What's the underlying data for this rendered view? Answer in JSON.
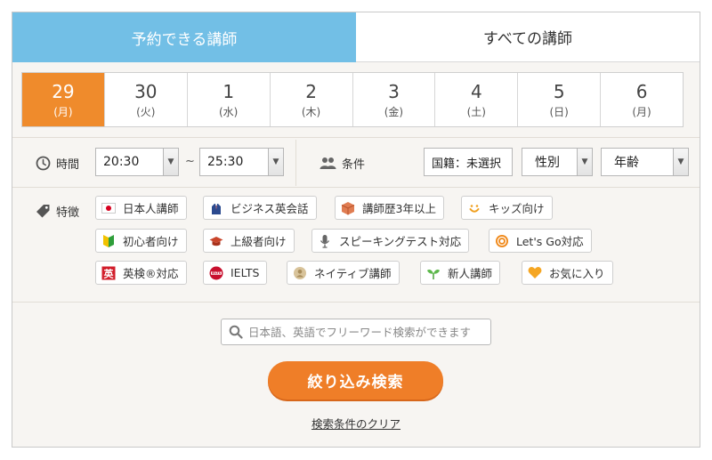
{
  "tabs": [
    {
      "label": "予約できる講師",
      "active": true
    },
    {
      "label": "すべての講師",
      "active": false
    }
  ],
  "dates": [
    {
      "day": "29",
      "weekday": "(月)",
      "selected": true
    },
    {
      "day": "30",
      "weekday": "(火)",
      "selected": false
    },
    {
      "day": "1",
      "weekday": "(水)",
      "selected": false
    },
    {
      "day": "2",
      "weekday": "(木)",
      "selected": false
    },
    {
      "day": "3",
      "weekday": "(金)",
      "selected": false
    },
    {
      "day": "4",
      "weekday": "(土)",
      "selected": false
    },
    {
      "day": "5",
      "weekday": "(日)",
      "selected": false
    },
    {
      "day": "6",
      "weekday": "(月)",
      "selected": false
    }
  ],
  "time": {
    "label": "時間",
    "icon": "clock-icon",
    "from": "20:30",
    "separator": "~",
    "to": "25:30"
  },
  "conditions": {
    "label": "条件",
    "icon": "people-icon",
    "nationality": "国籍：未選択",
    "gender": "性別",
    "age": "年齢"
  },
  "features": {
    "label": "特徴",
    "icon": "tag-icon",
    "chips": [
      {
        "label": "日本人講師",
        "icon": "japan-flag-icon"
      },
      {
        "label": "ビジネス英会話",
        "icon": "business-suit-icon"
      },
      {
        "label": "講師歴3年以上",
        "icon": "cube-icon"
      },
      {
        "label": "キッズ向け",
        "icon": "smile-icon"
      },
      {
        "label": "初心者向け",
        "icon": "beginner-mark-icon"
      },
      {
        "label": "上級者向け",
        "icon": "graduation-cap-icon"
      },
      {
        "label": "スピーキングテスト対応",
        "icon": "microphone-icon"
      },
      {
        "label": "Let's Go対応",
        "icon": "letsgo-icon"
      },
      {
        "label": "英検®対応",
        "icon": "eiken-icon"
      },
      {
        "label": "IELTS",
        "icon": "ielts-icon"
      },
      {
        "label": "ネイティブ講師",
        "icon": "native-badge-icon"
      },
      {
        "label": "新人講師",
        "icon": "sprout-icon"
      },
      {
        "label": "お気に入り",
        "icon": "heart-icon"
      }
    ]
  },
  "search": {
    "placeholder": "日本語、英語でフリーワード検索ができます",
    "icon": "search-icon"
  },
  "submit_label": "絞り込み検索",
  "clear_label": "検索条件のクリア",
  "colors": {
    "active_tab": "#72bfe6",
    "selected_date": "#ef8b2c",
    "submit_button": "#ef7e28"
  }
}
